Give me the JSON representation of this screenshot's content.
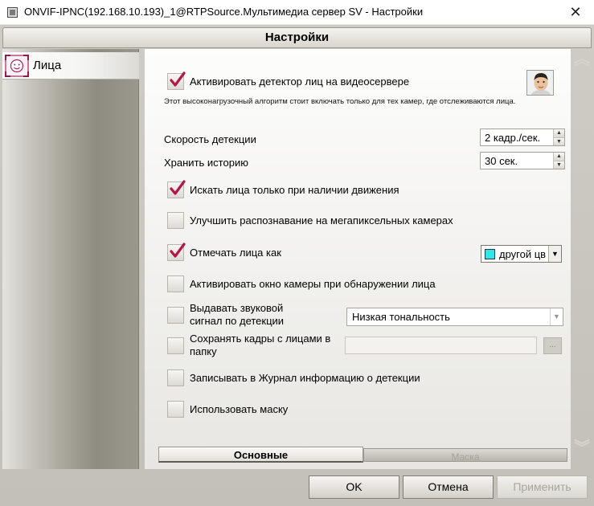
{
  "window": {
    "title": "ONVIF-IPNC(192.168.10.193)_1@RTPSource.Мультимедиа сервер SV - Настройки",
    "close_label": "✕"
  },
  "header": {
    "title": "Настройки"
  },
  "sidebar": {
    "items": [
      {
        "label": "Лица",
        "icon": "face-icon"
      }
    ]
  },
  "settings": {
    "activate_detector": {
      "label": "Активировать детектор лиц на видеосервере",
      "checked": true
    },
    "note": "Этот высоконагрузочный алгоритм стоит включать только для тех камер, где отслеживаются лица.",
    "detection_speed": {
      "label": "Скорость детекции",
      "value": "2 кадр./сек."
    },
    "keep_history": {
      "label": "Хранить историю",
      "value": "30 сек."
    },
    "search_motion": {
      "label": "Искать лица только при наличии движения",
      "checked": true
    },
    "improve_megapixel": {
      "label": "Улучшить распознавание на мегапиксельных камерах",
      "checked": false
    },
    "mark_faces": {
      "label": "Отмечать лица как",
      "checked": true,
      "color_value": "другой цв",
      "swatch_color": "#36e3e8"
    },
    "activate_window": {
      "label": "Активировать окно камеры при обнаружении лица",
      "checked": false
    },
    "sound_signal": {
      "label_line1": "Выдавать звуковой",
      "label_line2": "сигнал по детекции",
      "checked": false,
      "combo_value": "Низкая тональность"
    },
    "save_frames": {
      "label_line1": "Сохранять кадры с лицами в",
      "label_line2": "папку",
      "checked": false,
      "path_value": "",
      "browse_label": "..."
    },
    "write_journal": {
      "label": "Записывать в Журнал информацию о детекции",
      "checked": false
    },
    "use_mask": {
      "label": "Использовать маску",
      "checked": false
    }
  },
  "tabs": [
    {
      "label": "Основные",
      "active": true
    },
    {
      "label": "Маска",
      "active": false
    }
  ],
  "buttons": {
    "ok": "OK",
    "cancel": "Отмена",
    "apply": "Применить"
  },
  "colors": {
    "check_mark": "#b0174a",
    "sidebar_dark": "#8e8b80",
    "frame": "#c3c0b9"
  }
}
